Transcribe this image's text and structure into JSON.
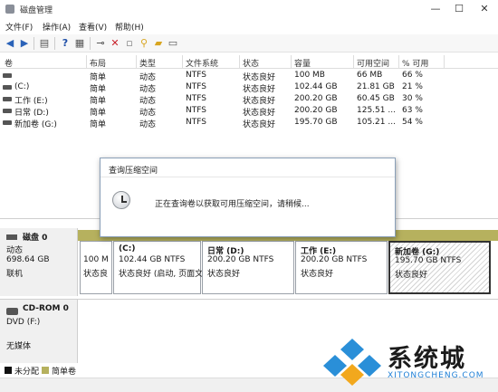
{
  "window": {
    "title": "磁盘管理"
  },
  "menu": [
    "文件(F)",
    "操作(A)",
    "查看(V)",
    "帮助(H)"
  ],
  "toolbar": [
    "back-icon",
    "forward-icon",
    "list-icon",
    "help-icon",
    "properties-icon",
    "connect-icon",
    "delete-icon",
    "new-icon",
    "search-icon",
    "open-icon",
    "view-icon"
  ],
  "columns": [
    "卷",
    "布局",
    "类型",
    "文件系统",
    "状态",
    "容量",
    "可用空间",
    "% 可用"
  ],
  "volumes": [
    {
      "name": "",
      "layout": "简单",
      "type": "动态",
      "fs": "NTFS",
      "status": "状态良好",
      "capacity": "100 MB",
      "free": "66 MB",
      "pct": "66 %"
    },
    {
      "name": "(C:)",
      "layout": "简单",
      "type": "动态",
      "fs": "NTFS",
      "status": "状态良好",
      "capacity": "102.44 GB",
      "free": "21.81 GB",
      "pct": "21 %"
    },
    {
      "name": "工作 (E:)",
      "layout": "简单",
      "type": "动态",
      "fs": "NTFS",
      "status": "状态良好",
      "capacity": "200.20 GB",
      "free": "60.45 GB",
      "pct": "30 %"
    },
    {
      "name": "日常 (D:)",
      "layout": "简单",
      "type": "动态",
      "fs": "NTFS",
      "status": "状态良好",
      "capacity": "200.20 GB",
      "free": "125.51 ...",
      "pct": "63 %"
    },
    {
      "name": "新加卷 (G:)",
      "layout": "简单",
      "type": "动态",
      "fs": "NTFS",
      "status": "状态良好",
      "capacity": "195.70 GB",
      "free": "105.21 ...",
      "pct": "54 %"
    }
  ],
  "dialog": {
    "title": "查询压缩空间",
    "message": "正在查询卷以获取可用压缩空间，请稍候..."
  },
  "disk0": {
    "name": "磁盘 0",
    "type": "动态",
    "size": "698.64 GB",
    "state": "联机"
  },
  "partitions": [
    {
      "name": "",
      "line1": "100 M",
      "line2": "状态良"
    },
    {
      "name": "(C:)",
      "line1": "102.44 GB NTFS",
      "line2": "状态良好 (启动, 页面文"
    },
    {
      "name": "日常  (D:)",
      "line1": "200.20 GB NTFS",
      "line2": "状态良好"
    },
    {
      "name": "工作  (E:)",
      "line1": "200.20 GB NTFS",
      "line2": "状态良好"
    },
    {
      "name": "新加卷  (G:)",
      "line1": "195.70 GB NTFS",
      "line2": "状态良好"
    }
  ],
  "cdrom": {
    "name": "CD-ROM 0",
    "drive": "DVD (F:)",
    "media": "无媒体"
  },
  "legend": [
    {
      "label": "未分配",
      "color": "#111111"
    },
    {
      "label": "简单卷",
      "color": "#b6b15e"
    }
  ],
  "brand": {
    "name": "系统城",
    "site": "XITONGCHENG.COM"
  }
}
